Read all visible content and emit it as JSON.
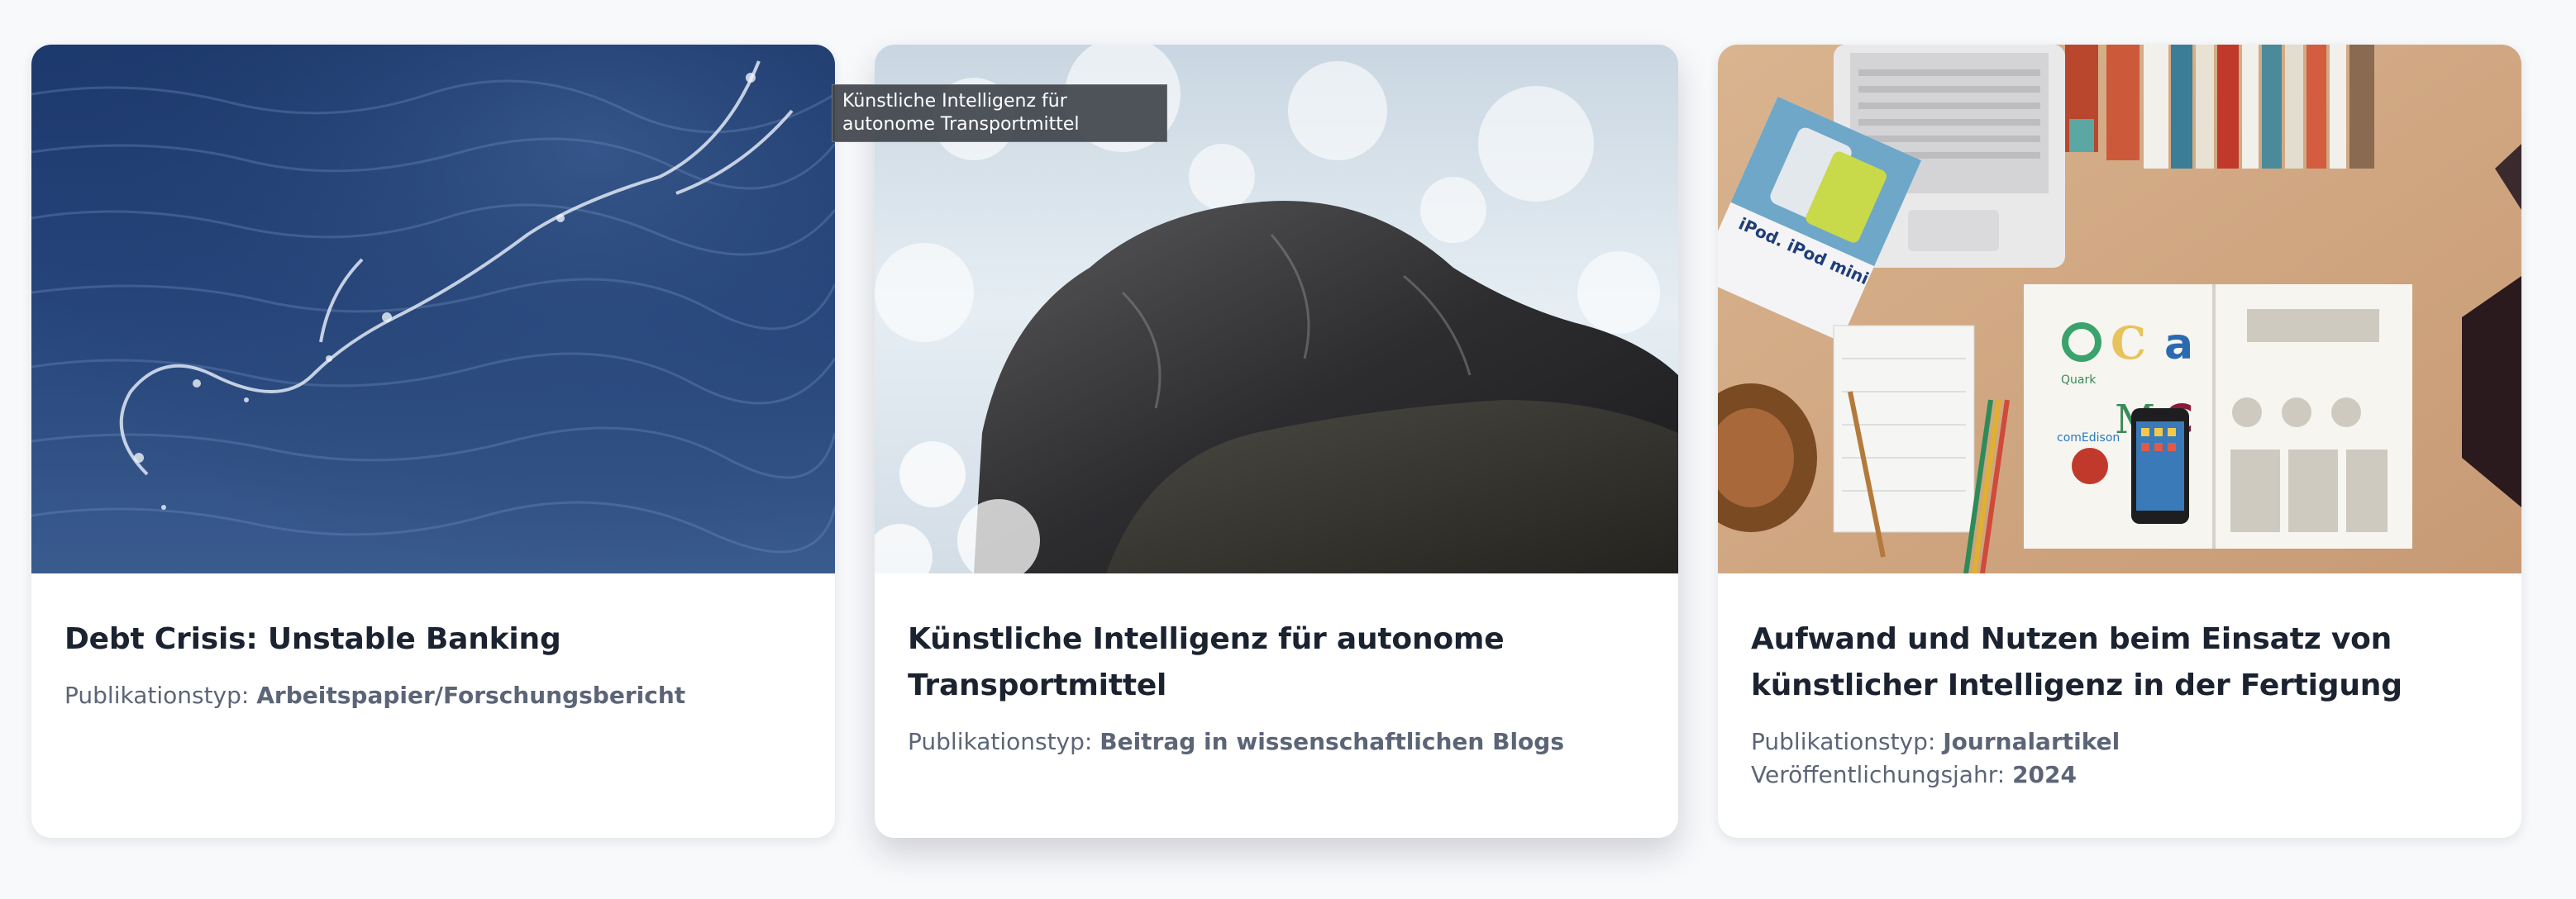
{
  "cards": [
    {
      "image_alt": "Dark blue ocean water surface",
      "title": "Debt Crisis: Unstable Banking",
      "type_label": "Publikationstyp:",
      "type_value": "Arbeitspapier/Forschungsbericht",
      "year_label": "",
      "year_value": ""
    },
    {
      "image_alt": "Rock with crashing white water",
      "title": "Künstliche Intelligenz für autonome Transportmittel",
      "type_label": "Publikationstyp:",
      "type_value": "Beitrag in wissenschaftlichen Blogs",
      "year_label": "",
      "year_value": ""
    },
    {
      "image_alt": "Desk with laptop, books, magazine and phone",
      "title": "Aufwand und Nutzen beim Einsatz von künstlicher Intelligenz in der Fertigung",
      "type_label": "Publikationstyp:",
      "type_value": "Journalartikel",
      "year_label": "Veröffentlichungsjahr:",
      "year_value": "2024"
    }
  ],
  "tooltip": {
    "text": "Künstliche Intelligenz für autonome Transportmittel"
  },
  "image_texts": {
    "magazine": "iPod. iPod mini",
    "logo1": "Quark",
    "logo2": "comEdison"
  },
  "colors": {
    "title": "#1b2230",
    "meta": "#5c6577",
    "page_bg": "#f8f9fb"
  }
}
